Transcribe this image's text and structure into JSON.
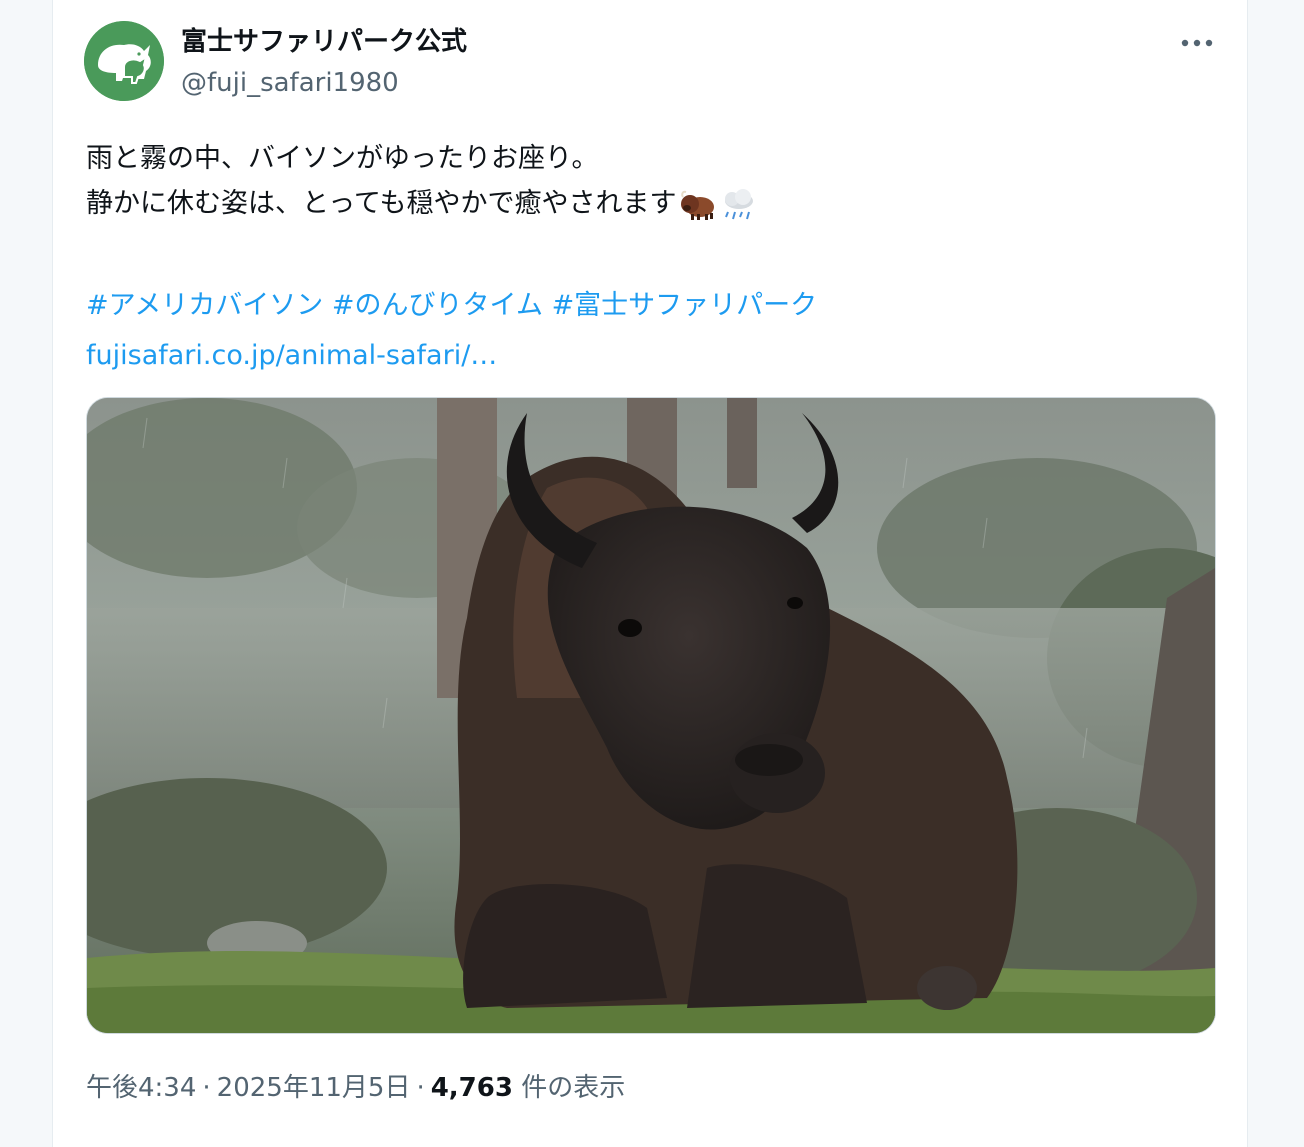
{
  "post": {
    "display_name": "富士サファリパーク公式",
    "handle": "@fuji_safari1980",
    "text_line_1": "雨と霧の中、バイソンがゆったりお座り。",
    "text_line_2": "静かに休む姿は、とっても穏やかで癒やされます",
    "emojis": [
      "bison-emoji",
      "cloud-with-rain-emoji"
    ],
    "hashtags": [
      "#アメリカバイソン",
      "#のんびりタイム",
      "#富士サファリパーク"
    ],
    "link": "fujisafari.co.jp/animal-safari/…",
    "time": "午後4:34",
    "date": "2025年11月5日",
    "views_count": "4,763",
    "views_label": "件の表示",
    "separator": "·"
  },
  "colors": {
    "link": "#1d9bf0",
    "text": "#0f1419",
    "secondary": "#536471",
    "avatar_bg": "#4a9a5a"
  }
}
